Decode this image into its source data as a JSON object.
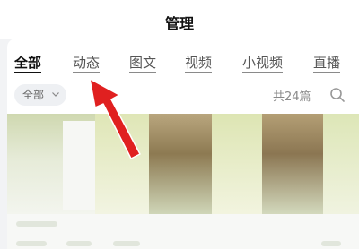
{
  "header": {
    "title": "管理"
  },
  "tabs": [
    {
      "label": "全部",
      "active": true
    },
    {
      "label": "动态",
      "active": false
    },
    {
      "label": "图文",
      "active": false
    },
    {
      "label": "视频",
      "active": false
    },
    {
      "label": "小视频",
      "active": false
    },
    {
      "label": "直播",
      "active": false
    }
  ],
  "filter": {
    "label": "全部",
    "icon": "chevron-down-icon"
  },
  "count": {
    "text": "共24篇"
  },
  "search": {
    "icon": "search-icon"
  },
  "annotation": {
    "color": "#e02020",
    "icon": "red-arrow-icon"
  }
}
